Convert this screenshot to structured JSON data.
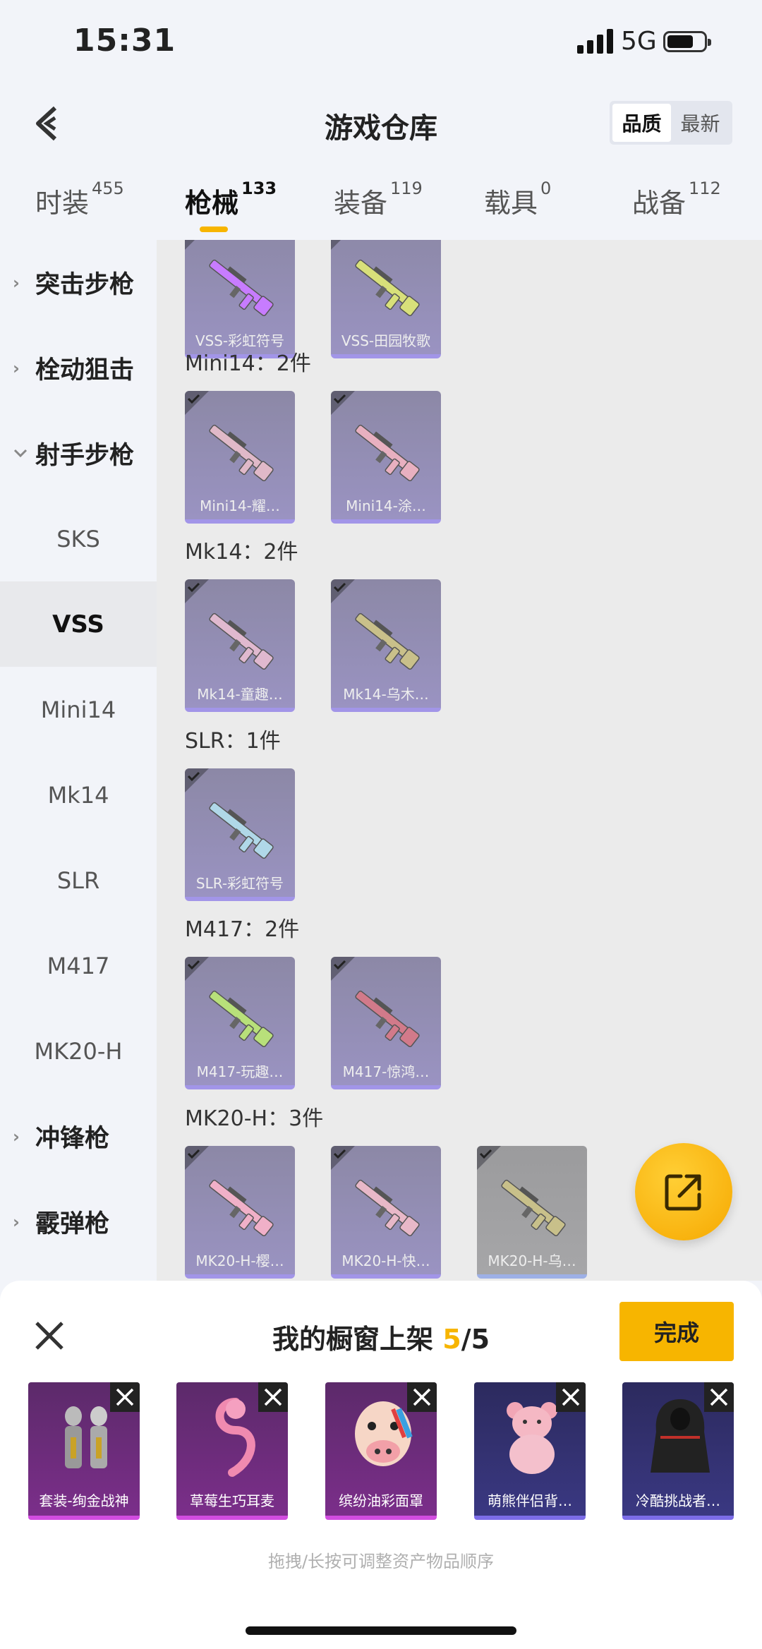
{
  "status_bar": {
    "time": "15:31",
    "network": "5G"
  },
  "header": {
    "title": "游戏仓库",
    "sort_options": [
      "品质",
      "最新"
    ],
    "active_sort": "品质"
  },
  "tabs": [
    {
      "label": "时装",
      "count": "455"
    },
    {
      "label": "枪械",
      "count": "133"
    },
    {
      "label": "装备",
      "count": "119"
    },
    {
      "label": "载具",
      "count": "0"
    },
    {
      "label": "战备",
      "count": "112"
    }
  ],
  "active_tab": "枪械",
  "sidebar": {
    "items": [
      {
        "label": "突击步枪",
        "type": "parent",
        "state": "collapsed"
      },
      {
        "label": "栓动狙击",
        "type": "parent",
        "state": "collapsed"
      },
      {
        "label": "射手步枪",
        "type": "parent",
        "state": "expanded"
      },
      {
        "label": "SKS",
        "type": "child"
      },
      {
        "label": "VSS",
        "type": "child",
        "selected": true
      },
      {
        "label": "Mini14",
        "type": "child"
      },
      {
        "label": "Mk14",
        "type": "child"
      },
      {
        "label": "SLR",
        "type": "child"
      },
      {
        "label": "M417",
        "type": "child"
      },
      {
        "label": "MK20-H",
        "type": "child"
      },
      {
        "label": "冲锋枪",
        "type": "parent",
        "state": "collapsed"
      },
      {
        "label": "霰弹枪",
        "type": "parent",
        "state": "collapsed"
      }
    ]
  },
  "groups": [
    {
      "label": "",
      "items": [
        {
          "name": "VSS-彩虹符号",
          "color": "#c77cff"
        },
        {
          "name": "VSS-田园牧歌",
          "color": "#d8e07a"
        }
      ]
    },
    {
      "label": "Mini14：2件",
      "items": [
        {
          "name": "Mini14-耀…",
          "color": "#e0b9c8"
        },
        {
          "name": "Mini14-涂…",
          "color": "#e8b0c0"
        }
      ]
    },
    {
      "label": "Mk14：2件",
      "items": [
        {
          "name": "Mk14-童趣…",
          "color": "#e0b9cf"
        },
        {
          "name": "Mk14-乌木…",
          "color": "#c9c08a"
        }
      ]
    },
    {
      "label": "SLR：1件",
      "items": [
        {
          "name": "SLR-彩虹符号",
          "color": "#b0d8e8"
        }
      ]
    },
    {
      "label": "M417：2件",
      "items": [
        {
          "name": "M417-玩趣…",
          "color": "#b8e07a"
        },
        {
          "name": "M417-惊鸿…",
          "color": "#d27a8a"
        }
      ]
    },
    {
      "label": "MK20-H：3件",
      "items": [
        {
          "name": "MK20-H-樱…",
          "color": "#f0b0c8"
        },
        {
          "name": "MK20-H-快…",
          "color": "#e8b8c8"
        },
        {
          "name": "MK20-H-乌…",
          "color": "#c8c08a",
          "grey": true
        }
      ]
    }
  ],
  "sheet": {
    "title_prefix": "我的橱窗上架",
    "current": "5",
    "total": "/5",
    "done_label": "完成",
    "hint": "拖拽/长按可调整资产物品顺序",
    "items": [
      {
        "name": "套装-绚金战神",
        "style": "purple"
      },
      {
        "name": "草莓生巧耳麦",
        "style": "purple"
      },
      {
        "name": "缤纷油彩面罩",
        "style": "purple"
      },
      {
        "name": "萌熊伴侣背…",
        "style": "blue"
      },
      {
        "name": "冷酷挑战者…",
        "style": "blue"
      }
    ]
  },
  "colors": {
    "accent": "#f7b500",
    "card_purple": "#9a93c2",
    "sheet_purple": "#7b2e8a"
  }
}
